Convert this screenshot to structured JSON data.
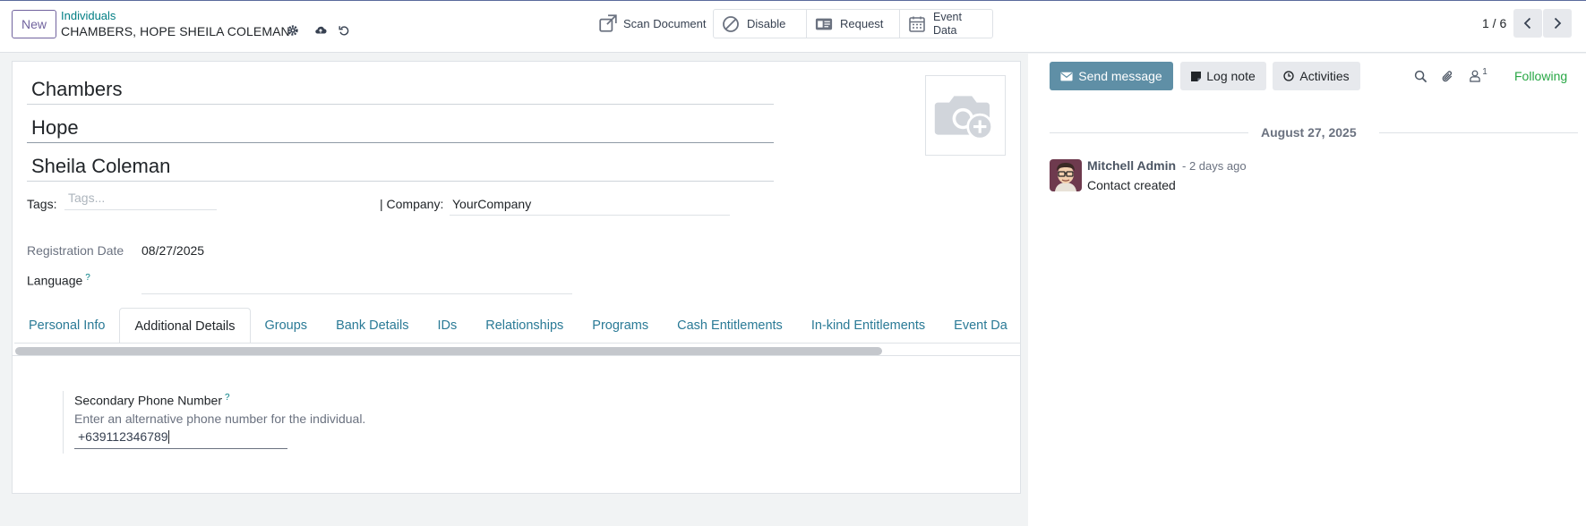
{
  "control_panel": {
    "new_label": "New",
    "breadcrumb_parent": "Individuals",
    "breadcrumb_current": "CHAMBERS, HOPE SHEILA COLEMAN",
    "actions": {
      "scan_document": "Scan Document",
      "disable": "Disable",
      "request": "Request",
      "event_data_line1": "Event",
      "event_data_line2": "Data"
    },
    "pager": "1 / 6"
  },
  "form": {
    "family_name": "Chambers",
    "given_name": "Hope",
    "addl_name": "Sheila Coleman",
    "tags_label": "Tags:",
    "tags_placeholder": "Tags...",
    "company_label": "| Company:",
    "company_value": "YourCompany",
    "registration_date_label": "Registration Date",
    "registration_date_value": "08/27/2025",
    "language_label": "Language",
    "help_mark": "?",
    "tabs": [
      {
        "label": "Personal Info",
        "active": false
      },
      {
        "label": "Additional Details",
        "active": true
      },
      {
        "label": "Groups",
        "active": false
      },
      {
        "label": "Bank Details",
        "active": false
      },
      {
        "label": "IDs",
        "active": false
      },
      {
        "label": "Relationships",
        "active": false
      },
      {
        "label": "Programs",
        "active": false
      },
      {
        "label": "Cash Entitlements",
        "active": false
      },
      {
        "label": "In-kind Entitlements",
        "active": false
      },
      {
        "label": "Event Da",
        "active": false
      }
    ],
    "secondary_phone": {
      "label": "Secondary Phone Number",
      "help": "Enter an alternative phone number for the individual.",
      "value": "+639112346789"
    }
  },
  "chatter": {
    "send_message": "Send message",
    "log_note": "Log note",
    "activities": "Activities",
    "followers_count": "1",
    "following": "Following",
    "date_separator": "August 27, 2025",
    "message": {
      "author": "Mitchell Admin",
      "time": "- 2 days ago",
      "body": "Contact created"
    }
  },
  "colors": {
    "brand": "#71639e",
    "link": "#017e84",
    "send_button": "#5f8fa6",
    "following": "#28a745"
  }
}
